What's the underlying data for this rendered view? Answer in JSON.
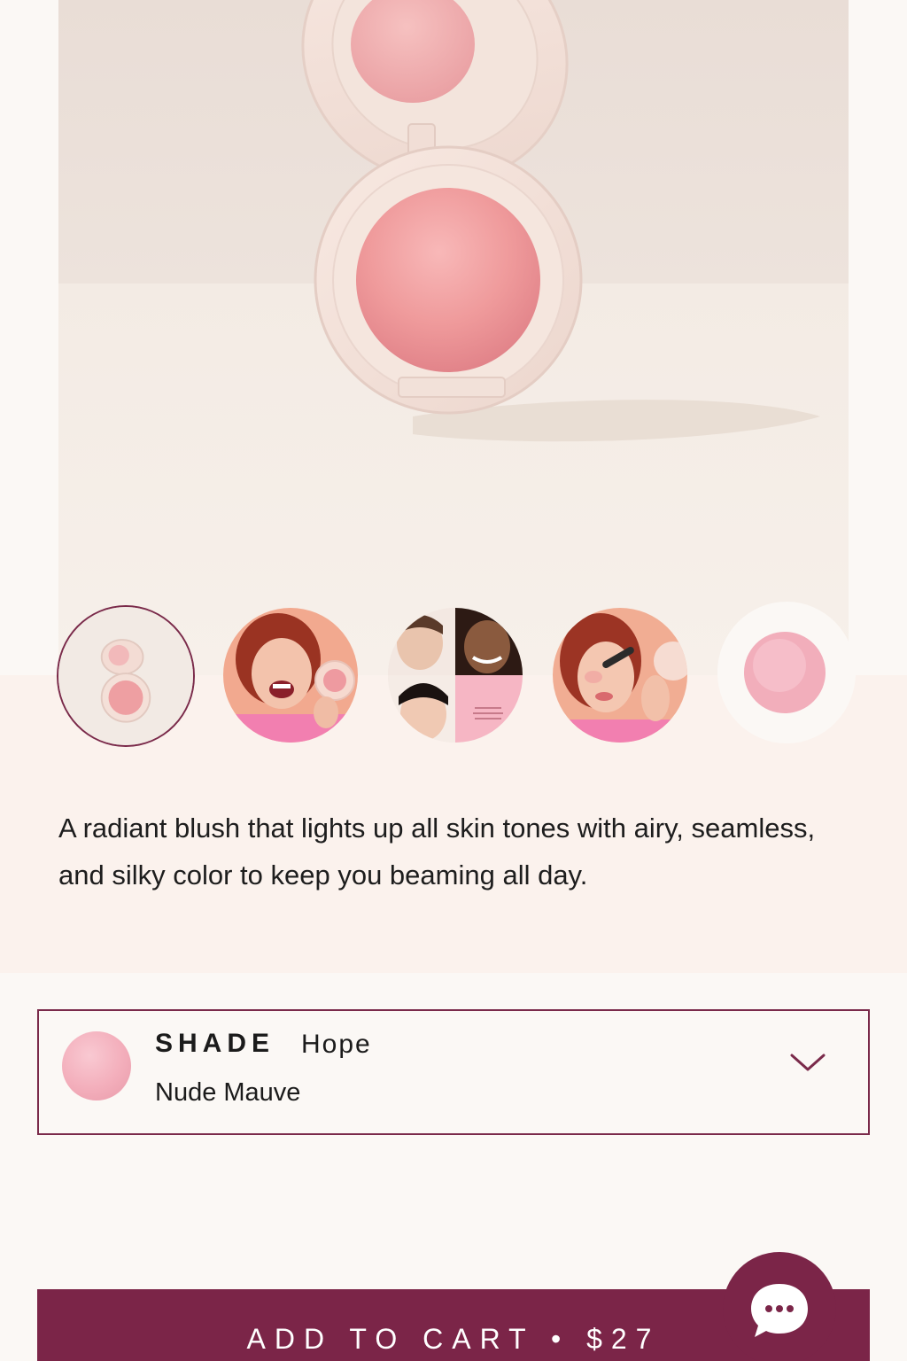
{
  "gallery": {
    "thumbnails": [
      {
        "name": "compact-product",
        "selected": true
      },
      {
        "name": "model-smiling-with-compact",
        "selected": false
      },
      {
        "name": "model-collage",
        "selected": false
      },
      {
        "name": "model-applying-blush",
        "selected": false
      },
      {
        "name": "shade-swatch",
        "selected": false
      }
    ]
  },
  "product": {
    "description": "A radiant blush that lights up all skin tones with airy, seamless, and silky color to keep you beaming all day."
  },
  "shade_selector": {
    "label": "SHADE",
    "shade_name": "Hope",
    "shade_description": "Nude Mauve",
    "swatch_color": "#f3aebb",
    "icon": "chevron-down-icon"
  },
  "cart": {
    "label": "ADD TO CART • $27"
  },
  "chat": {
    "icon": "chat-bubble-icon"
  },
  "colors": {
    "accent": "#7b2548",
    "background": "#fbf8f5",
    "band": "#fbf2ed"
  }
}
